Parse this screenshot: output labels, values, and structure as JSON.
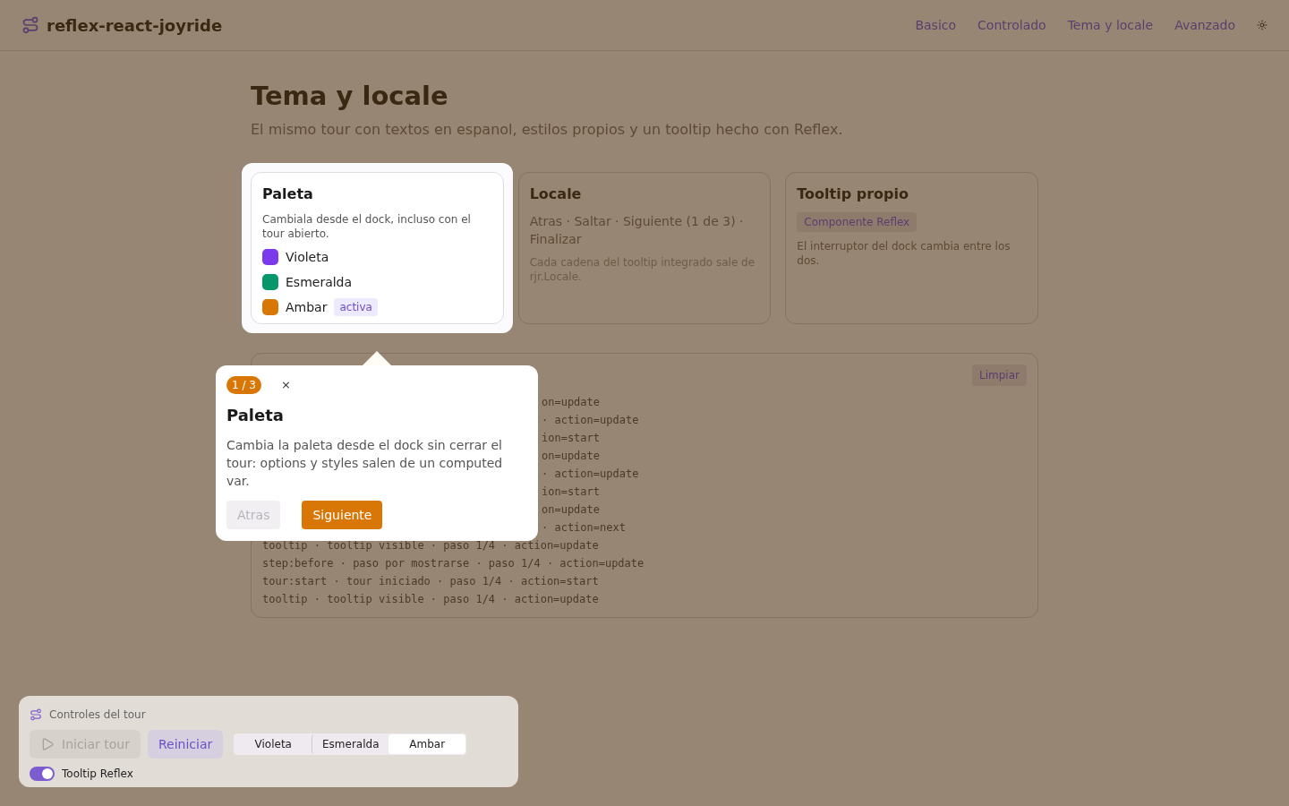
{
  "header": {
    "title": "reflex-react-joyride",
    "nav": [
      "Basico",
      "Controlado",
      "Tema y locale",
      "Avanzado"
    ]
  },
  "page": {
    "title": "Tema y locale",
    "subtitle": "El mismo tour con textos en espanol, estilos propios y un tooltip hecho con Reflex."
  },
  "cards": [
    {
      "kind": "palette",
      "highlighted": true,
      "title": "Paleta",
      "description": "Cambiala desde el dock, incluso con el tour abierto.",
      "swatches": [
        {
          "label": "Violeta",
          "color": "#7c3aed"
        },
        {
          "label": "Esmeralda",
          "color": "#059669"
        },
        {
          "label": "Ambar",
          "color": "#d97706",
          "badge": "activa"
        }
      ]
    },
    {
      "kind": "locale",
      "highlighted": false,
      "title": "Locale",
      "strings": "Atras · Saltar · Siguiente (1 de 3) · Finalizar",
      "note": "Cada cadena del tooltip integrado sale de rjr.Locale."
    },
    {
      "kind": "custom",
      "highlighted": false,
      "title": "Tooltip propio",
      "badge": "Componente Reflex",
      "description": "El interruptor del dock cambia entre los dos."
    }
  ],
  "log": {
    "clear_button": "Limpiar",
    "partly_hidden_lines": [
      "on=update",
      "· action=update",
      "ion=start",
      "on=update",
      "· action=update",
      "ion=start",
      "on=update",
      "· action=next"
    ],
    "lines": [
      "tooltip · tooltip visible · paso 1/4 · action=update",
      "step:before · paso por mostrarse · paso 1/4 · action=update",
      "tour:start · tour iniciado · paso 1/4 · action=start",
      "tooltip · tooltip visible · paso 1/4 · action=update"
    ]
  },
  "tooltip": {
    "step": "1 / 3",
    "close": "×",
    "title": "Paleta",
    "body": "Cambia la paleta desde el dock sin cerrar el tour: options y styles salen de un computed var.",
    "back_button": {
      "label": "Atras",
      "disabled": true
    },
    "next_button": {
      "label": "Siguiente",
      "disabled": false
    }
  },
  "dock": {
    "title": "Controles del tour",
    "start_button": {
      "label": "Iniciar tour",
      "disabled": true
    },
    "restart_button": {
      "label": "Reiniciar",
      "disabled": false
    },
    "palettes": [
      {
        "label": "Violeta",
        "selected": false
      },
      {
        "label": "Esmeralda",
        "selected": false
      },
      {
        "label": "Ambar",
        "selected": true
      }
    ],
    "toggle": {
      "label": "Tooltip Reflex",
      "on": true
    }
  }
}
